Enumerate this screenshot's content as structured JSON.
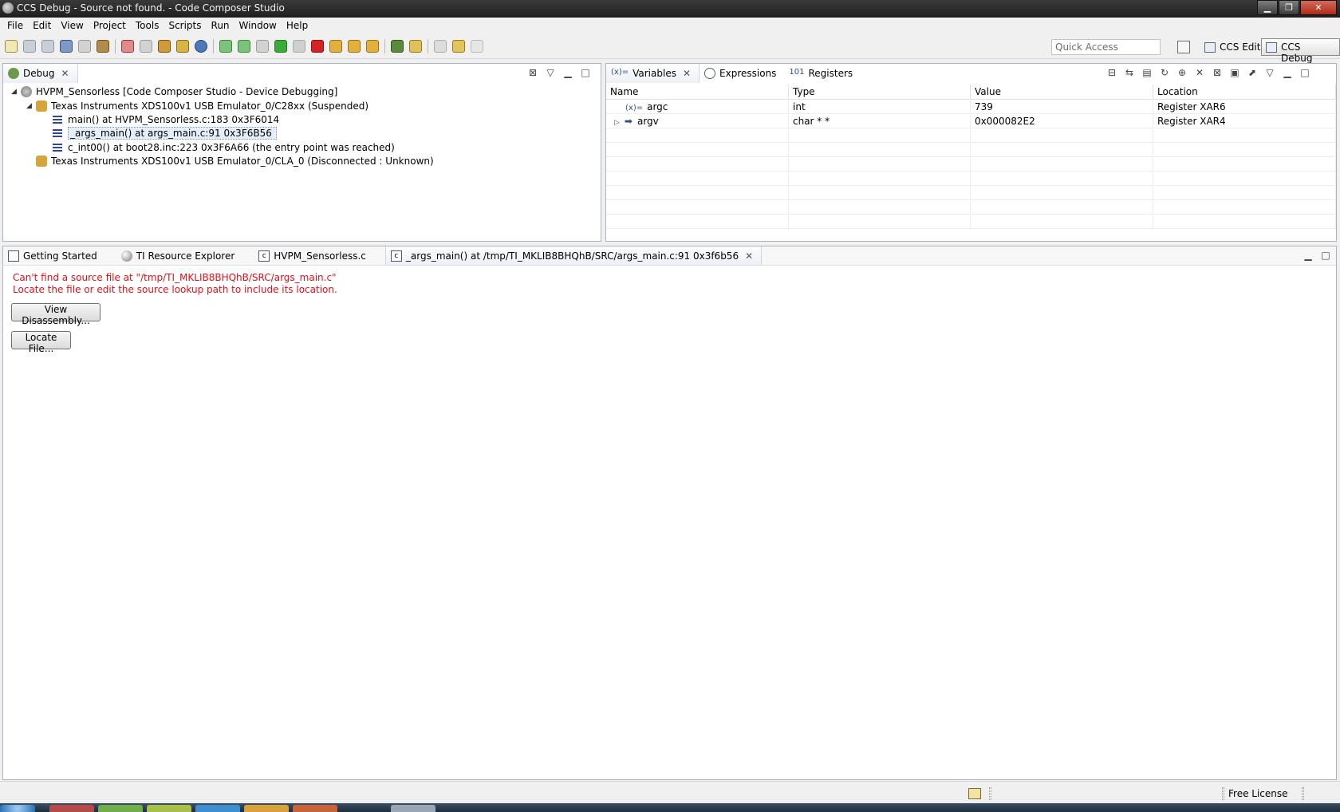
{
  "window": {
    "title": "CCS Debug - Source not found. - Code Composer Studio"
  },
  "menu": [
    "File",
    "Edit",
    "View",
    "Project",
    "Tools",
    "Scripts",
    "Run",
    "Window",
    "Help"
  ],
  "toolbar": {
    "quick_access_placeholder": "Quick Access"
  },
  "perspectives": {
    "edit": "CCS Edit",
    "debug": "CCS Debug"
  },
  "debug_view": {
    "tab_label": "Debug",
    "tree": {
      "project": "HVPM_Sensorless [Code Composer Studio - Device Debugging]",
      "target1": "Texas Instruments XDS100v1 USB Emulator_0/C28xx (Suspended)",
      "frames": [
        "main() at HVPM_Sensorless.c:183 0x3F6014",
        "_args_main() at args_main.c:91 0x3F6B56",
        "c_int00() at boot28.inc:223 0x3F6A66  (the entry point was reached)"
      ],
      "target2": "Texas Instruments XDS100v1 USB Emulator_0/CLA_0 (Disconnected : Unknown)"
    }
  },
  "variables_view": {
    "tabs": {
      "variables": "Variables",
      "expressions": "Expressions",
      "registers": "Registers"
    },
    "columns": {
      "name": "Name",
      "type": "Type",
      "value": "Value",
      "location": "Location"
    },
    "rows": [
      {
        "name": "argc",
        "type": "int",
        "value": "739",
        "location": "Register XAR6"
      },
      {
        "name": "argv",
        "type": "char * *",
        "value": "0x000082E2",
        "location": "Register XAR4"
      }
    ]
  },
  "editor": {
    "tabs": {
      "getting_started": "Getting Started",
      "resource_explorer": "TI Resource Explorer",
      "hvpm_file": "HVPM_Sensorless.c",
      "args_main": "_args_main() at /tmp/TI_MKLIB8BHQhB/SRC/args_main.c:91 0x3f6b56"
    },
    "error_line1": "Can't find a source file at \"/tmp/TI_MKLIB8BHQhB/SRC/args_main.c\"",
    "error_line2": "Locate the file or edit the source lookup path to include its location.",
    "view_disassembly_button": "View Disassembly...",
    "locate_file_button": "Locate File..."
  },
  "status": {
    "license": "Free License"
  },
  "colors": {
    "error_text": "#e0101a",
    "selection": "#e6eef8",
    "panel_border": "#aab4bf"
  }
}
